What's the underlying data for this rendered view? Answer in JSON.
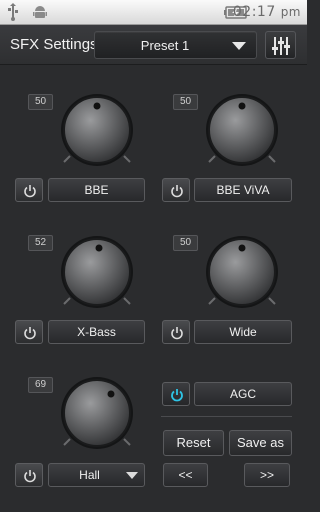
{
  "status_bar": {
    "time": "02:17",
    "ampm": "pm",
    "icons": [
      "usb-icon",
      "android-debug-icon",
      "battery-charging-icon"
    ]
  },
  "header": {
    "title": "SFX Settings",
    "preset": "Preset 1",
    "eq_button_icon": "equalizer-sliders-icon"
  },
  "effects": [
    {
      "key": "bbe",
      "label": "BBE",
      "value": "50"
    },
    {
      "key": "bbe_viva",
      "label": "BBE ViVA",
      "value": "50"
    },
    {
      "key": "xbass",
      "label": "X-Bass",
      "value": "52"
    },
    {
      "key": "wide",
      "label": "Wide",
      "value": "50"
    },
    {
      "key": "reverb",
      "label": "Hall",
      "value": "69"
    }
  ],
  "agc": {
    "label": "AGC",
    "state": "on",
    "accent": "#2ec4e6"
  },
  "actions": {
    "reset": "Reset",
    "save_as": "Save as",
    "prev": "<<",
    "next": ">>"
  },
  "colors": {
    "background": "#2b2c2e",
    "accent": "#2ec4e6"
  }
}
